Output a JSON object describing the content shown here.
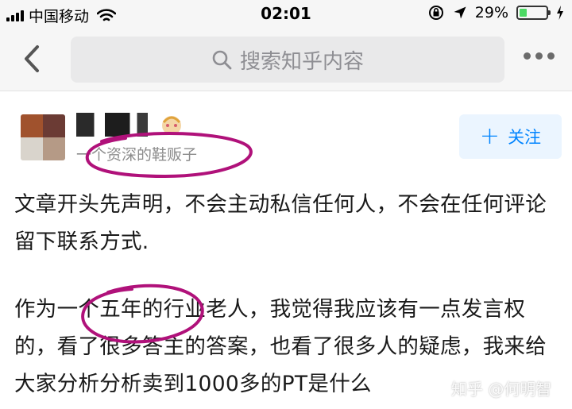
{
  "status_bar": {
    "carrier": "中国移动",
    "time": "02:01",
    "battery_percent": "29%",
    "battery_level": 0.29,
    "icons": [
      "signal-icon",
      "wifi-icon",
      "rotation-lock-icon",
      "location-icon",
      "battery-icon",
      "charging-icon"
    ]
  },
  "nav": {
    "back_icon": "chevron-left-icon",
    "search_placeholder": "搜索知乎内容",
    "search_icon": "search-icon",
    "more_icon": "more-icon"
  },
  "author": {
    "bio": "一个资深的鞋贩子",
    "follow_label": "关注",
    "follow_icon": "plus-icon"
  },
  "article": {
    "paragraphs": [
      "文章开头先声明，不会主动私信任何人，不会在任何评论留下联系方式.",
      "作为一个五年的行业老人，我觉得我应该有一点发言权的，看了很多答主的答案，也看了很多人的疑虑，我来给大家分析分析卖到1000多的PT是什么"
    ]
  },
  "watermark": "知乎 @何明智",
  "colors": {
    "accent": "#0084ff",
    "annotation": "#b0117a"
  }
}
